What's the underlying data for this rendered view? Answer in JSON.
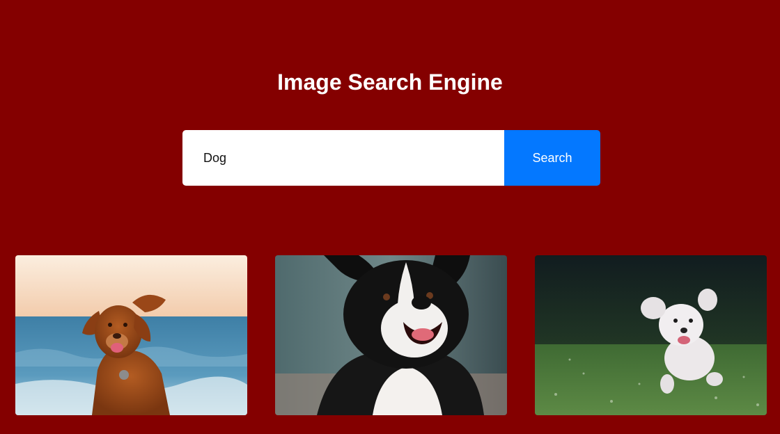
{
  "page": {
    "title": "Image Search Engine"
  },
  "search": {
    "value": "Dog",
    "button_label": "Search"
  },
  "colors": {
    "background": "#840000",
    "accent": "#0478ff",
    "title_text": "#ffffff"
  },
  "results": [
    {
      "name": "dog-image-1",
      "subject": "brown retriever on beach"
    },
    {
      "name": "dog-image-2",
      "subject": "black and white border collie"
    },
    {
      "name": "dog-image-3",
      "subject": "white fluffy dog running on grass"
    }
  ]
}
